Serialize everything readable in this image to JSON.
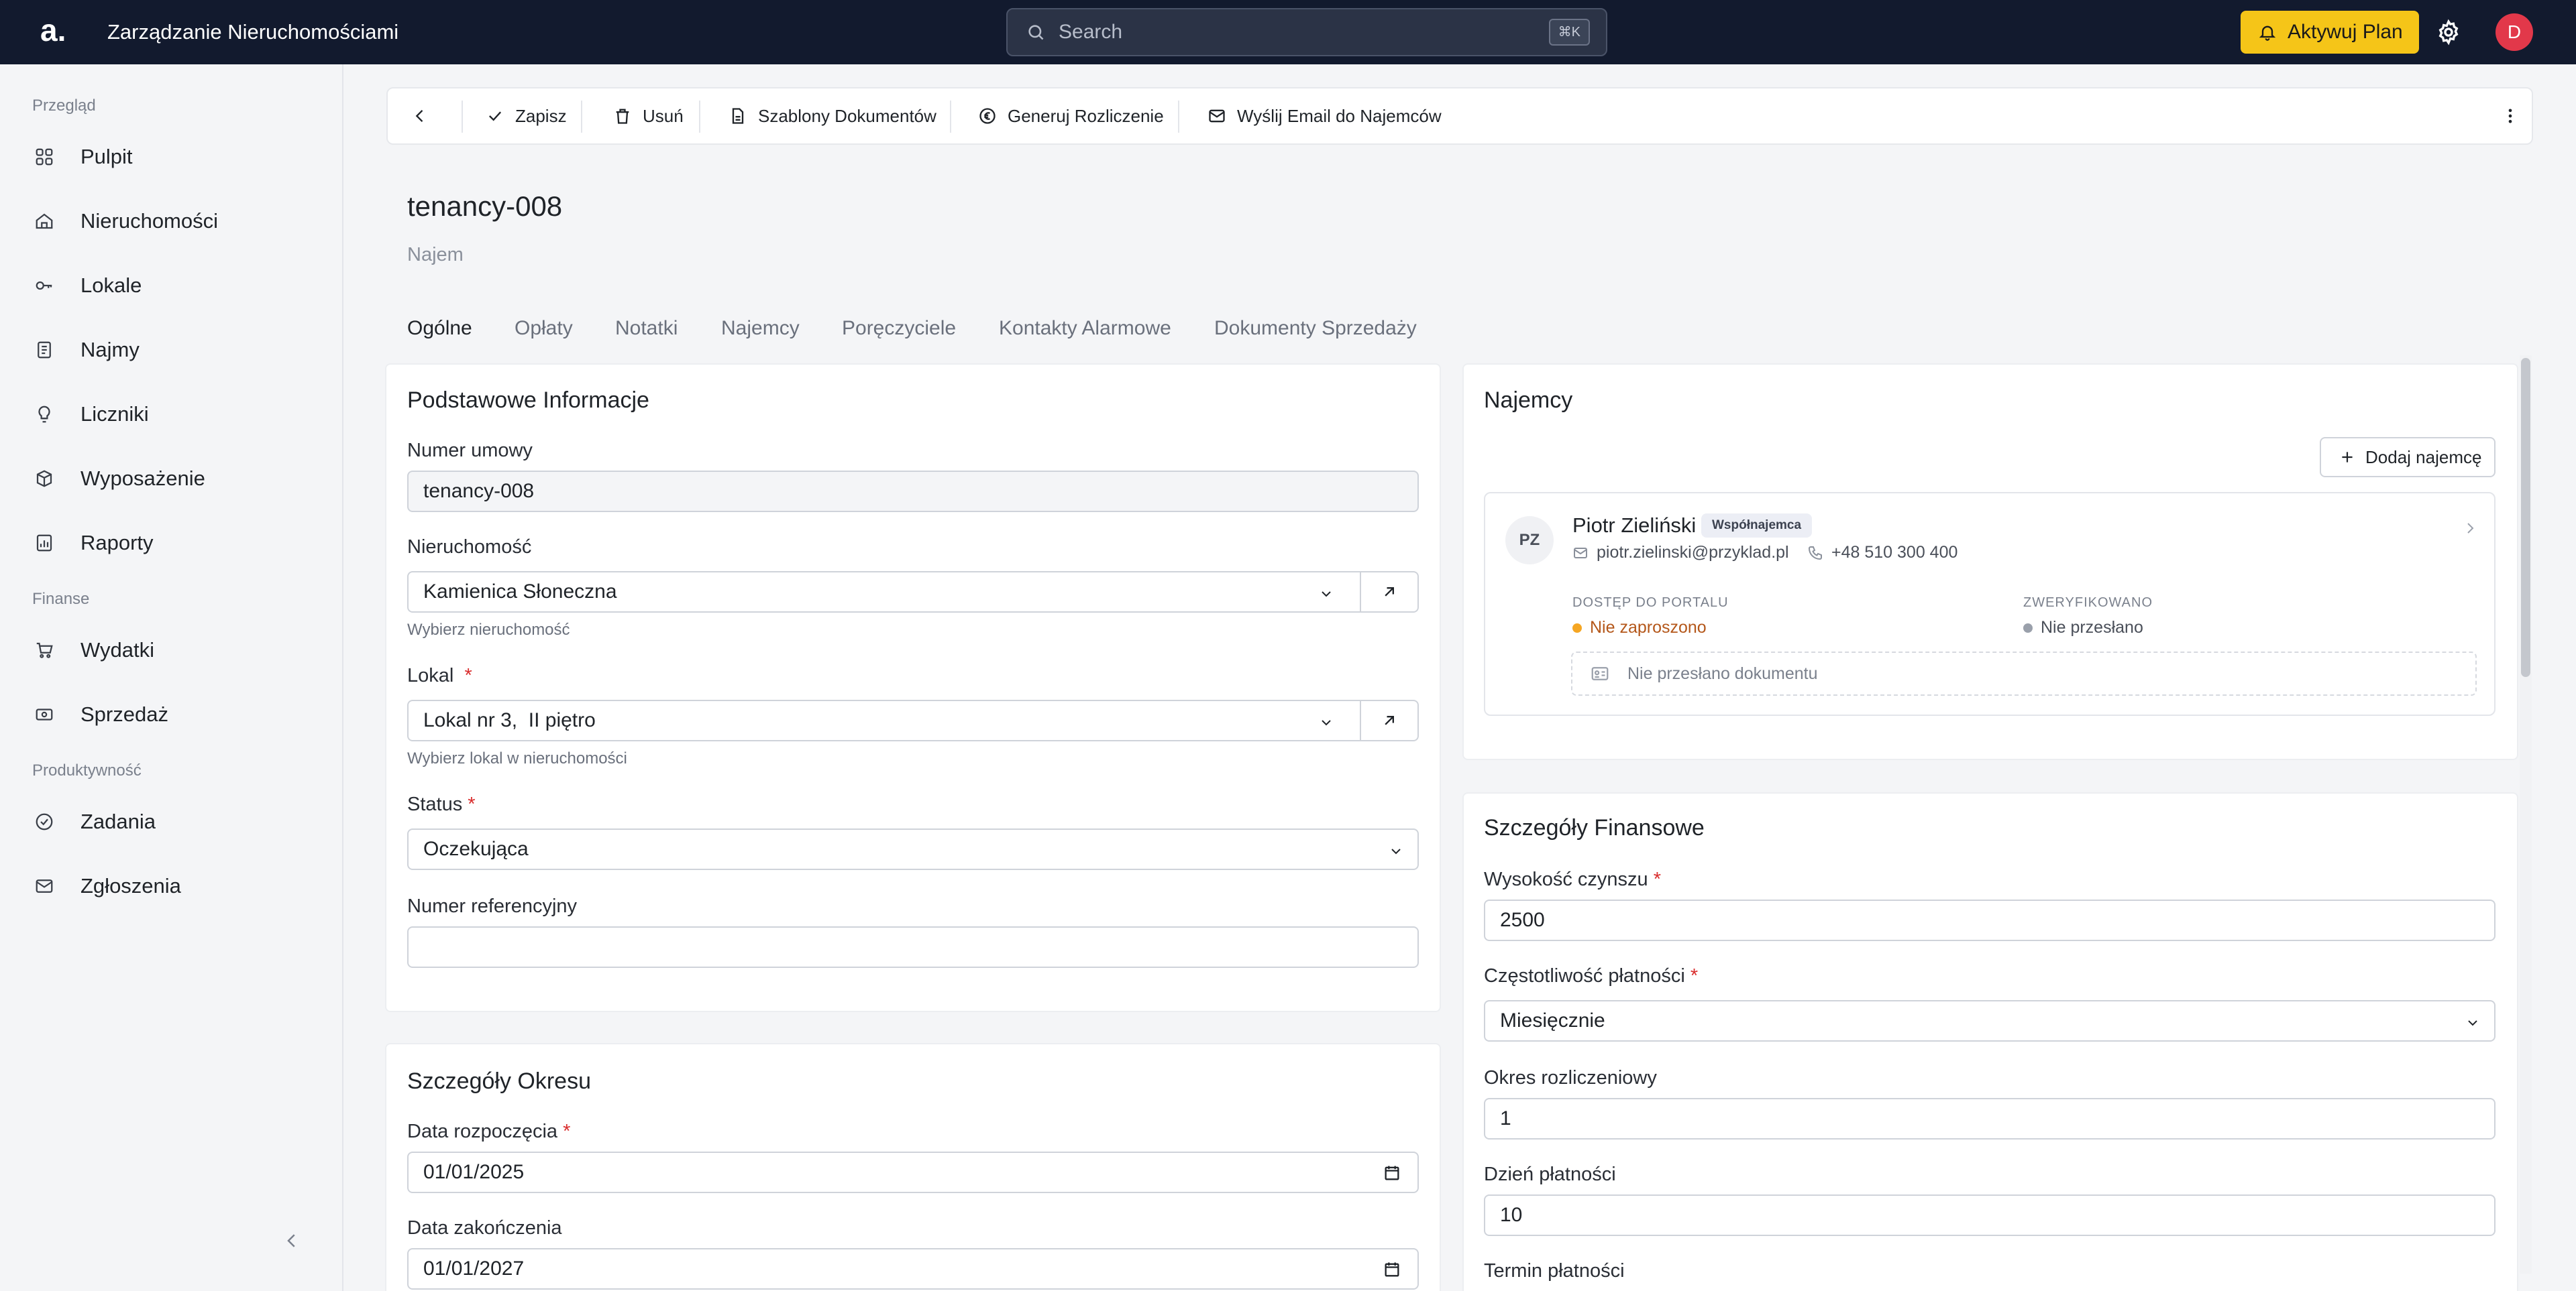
{
  "app": {
    "logo": "a.",
    "title": "Zarządzanie Nieruchomościami"
  },
  "search": {
    "placeholder": "Search",
    "shortcut": "⌘K"
  },
  "header": {
    "upgrade_label": "Aktywuj Plan",
    "avatar_initial": "D"
  },
  "sidebar": {
    "sections": [
      {
        "label": "Przegląd",
        "items": [
          {
            "label": "Pulpit",
            "icon": "grid-icon"
          },
          {
            "label": "Nieruchomości",
            "icon": "house-icon"
          },
          {
            "label": "Lokale",
            "icon": "key-icon"
          },
          {
            "label": "Najmy",
            "icon": "document-icon"
          },
          {
            "label": "Liczniki",
            "icon": "bulb-icon"
          },
          {
            "label": "Wyposażenie",
            "icon": "box-icon"
          },
          {
            "label": "Raporty",
            "icon": "chart-icon"
          }
        ]
      },
      {
        "label": "Finanse",
        "items": [
          {
            "label": "Wydatki",
            "icon": "cart-icon"
          },
          {
            "label": "Sprzedaż",
            "icon": "banknote-icon"
          }
        ]
      },
      {
        "label": "Produktywność",
        "items": [
          {
            "label": "Zadania",
            "icon": "check-circle-icon"
          },
          {
            "label": "Zgłoszenia",
            "icon": "mail-icon"
          }
        ]
      }
    ]
  },
  "toolbar": {
    "save": "Zapisz",
    "delete": "Usuń",
    "templates": "Szablony Dokumentów",
    "settlement": "Generuj Rozliczenie",
    "email": "Wyślij Email do Najemców"
  },
  "page": {
    "title": "tenancy-008",
    "subtitle": "Najem"
  },
  "tabs": [
    "Ogólne",
    "Opłaty",
    "Notatki",
    "Najemcy",
    "Poręczyciele",
    "Kontakty Alarmowe",
    "Dokumenty Sprzedaży"
  ],
  "basic": {
    "title": "Podstawowe Informacje",
    "contract_label": "Numer umowy",
    "contract_value": "tenancy-008",
    "property_label": "Nieruchomość",
    "property_value": "Kamienica Słoneczna",
    "property_hint": "Wybierz nieruchomość",
    "unit_label": "Lokal",
    "unit_value": "Lokal nr 3,  II piętro",
    "unit_hint": "Wybierz lokal w nieruchomości",
    "status_label": "Status",
    "status_value": "Oczekująca",
    "ref_label": "Numer referencyjny",
    "ref_value": ""
  },
  "period": {
    "title": "Szczegóły Okresu",
    "start_label": "Data rozpoczęcia",
    "start_value": "01/01/2025",
    "end_label": "Data zakończenia",
    "end_value": "01/01/2027"
  },
  "tenants": {
    "title": "Najemcy",
    "add_label": "Dodaj najemcę",
    "item": {
      "initials": "PZ",
      "name": "Piotr Zieliński",
      "role": "Współnajemca",
      "email": "piotr.zielinski@przyklad.pl",
      "phone": "+48 510 300 400",
      "portal_label": "DOSTĘP DO PORTALU",
      "portal_status": "Nie zaproszono",
      "verified_label": "ZWERYFIKOWANO",
      "verified_status": "Nie przesłano",
      "doc_text": "Nie przesłano dokumentu"
    }
  },
  "finance": {
    "title": "Szczegóły Finansowe",
    "rent_label": "Wysokość czynszu",
    "rent_value": "2500",
    "freq_label": "Częstotliwość płatności",
    "freq_value": "Miesięcznie",
    "period_label": "Okres rozliczeniowy",
    "period_value": "1",
    "day_label": "Dzień płatności",
    "day_value": "10",
    "due_label": "Termin płatności"
  },
  "colors": {
    "topbar": "#121a2e",
    "accent": "#f5c518",
    "avatar": "#e2384a",
    "warning": "#f5a623",
    "required": "#d92d2d"
  }
}
